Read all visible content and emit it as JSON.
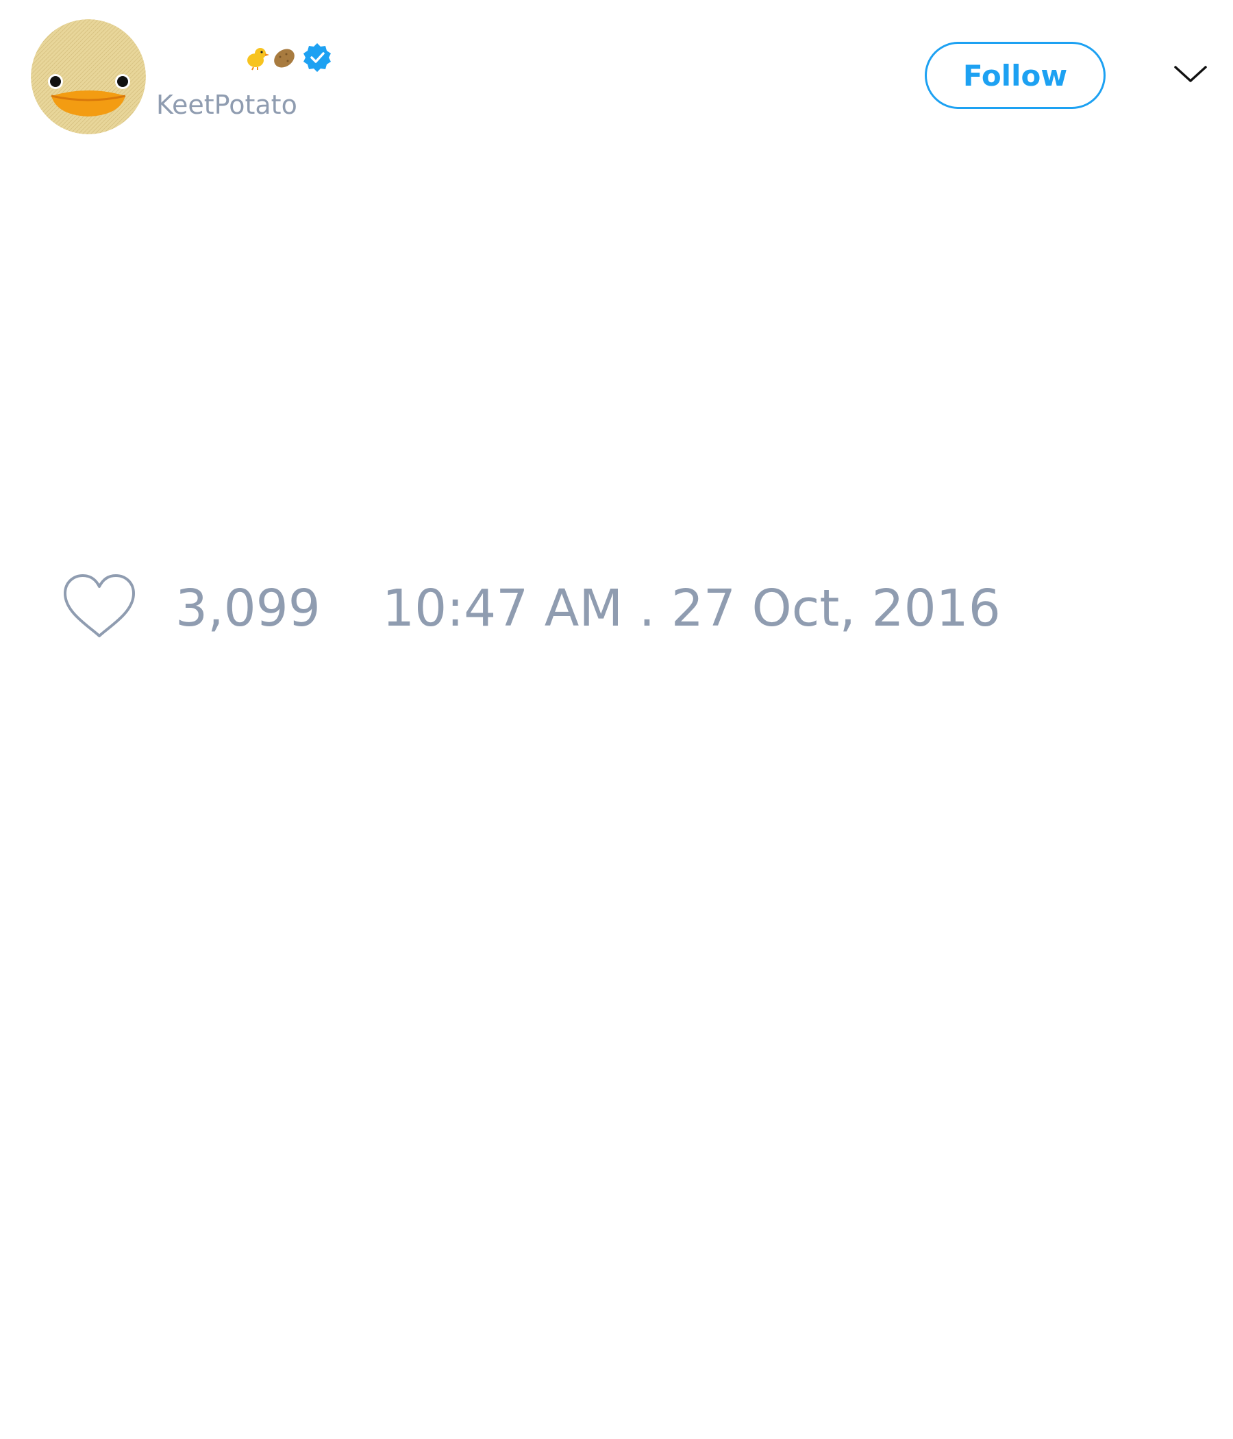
{
  "author": {
    "display_name_emojis": [
      "chick-emoji",
      "potato-emoji"
    ],
    "verified": true,
    "handle": "KeetPotato",
    "avatar_icon": "duck-face-icon"
  },
  "actions": {
    "follow_label": "Follow",
    "menu_icon": "chevron-down-icon"
  },
  "engagement": {
    "like_icon": "heart-outline-icon",
    "like_count": "3,099"
  },
  "meta": {
    "timestamp": "10:47 AM . 27 Oct, 2016"
  },
  "colors": {
    "accent": "#1da1f2",
    "muted_text": "#8f9cb0",
    "background": "#ffffff"
  }
}
